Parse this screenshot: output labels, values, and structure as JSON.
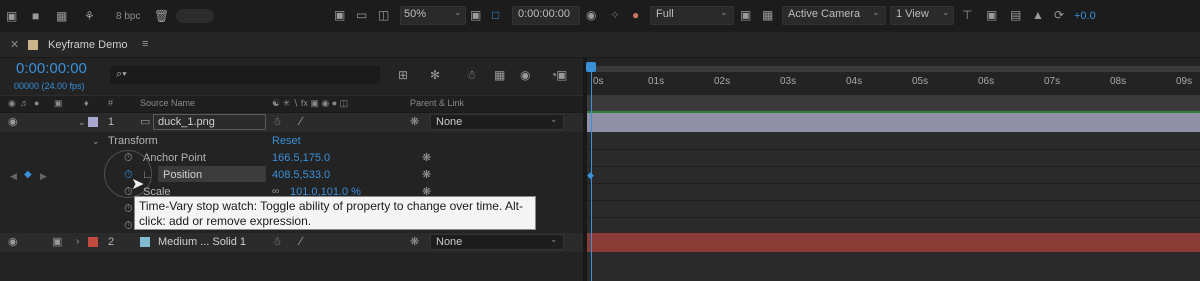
{
  "viewer_bar": {
    "bpc": "8 bpc",
    "zoom": "50%",
    "timecode": "0:00:00:00",
    "resolution": "Full",
    "camera": "Active Camera",
    "view": "1 View",
    "exposure": "+0.0"
  },
  "comp_tab": {
    "title": "Keyframe Demo"
  },
  "timeline": {
    "current_time": "0:00:00:00",
    "frame_info": "00000 (24.00 fps)",
    "search_placeholder": "⌕▾",
    "ruler_ticks": [
      "0s",
      "01s",
      "02s",
      "03s",
      "04s",
      "05s",
      "06s",
      "07s",
      "08s",
      "09s"
    ]
  },
  "columns": {
    "source_name": "Source Name",
    "parent_link": "Parent & Link",
    "hash": "#"
  },
  "layers": [
    {
      "index": "1",
      "name": "duck_1.png",
      "parent": "None",
      "label_color": "#a9a9cf"
    },
    {
      "index": "2",
      "name": "Medium ... Solid 1",
      "parent": "None",
      "label_color": "#c24a3f",
      "swatch": "#7fbcd0"
    }
  ],
  "transform": {
    "label": "Transform",
    "reset": "Reset",
    "properties": [
      {
        "name": "Anchor Point",
        "value": "166.5,175.0"
      },
      {
        "name": "Position",
        "value": "408.5,533.0"
      },
      {
        "name": "Scale",
        "value": "101.0,101.0 %"
      }
    ]
  },
  "tooltip": {
    "text": "Time-Vary stop watch: Toggle ability of property to change over time. Alt-click: add or remove expression."
  }
}
